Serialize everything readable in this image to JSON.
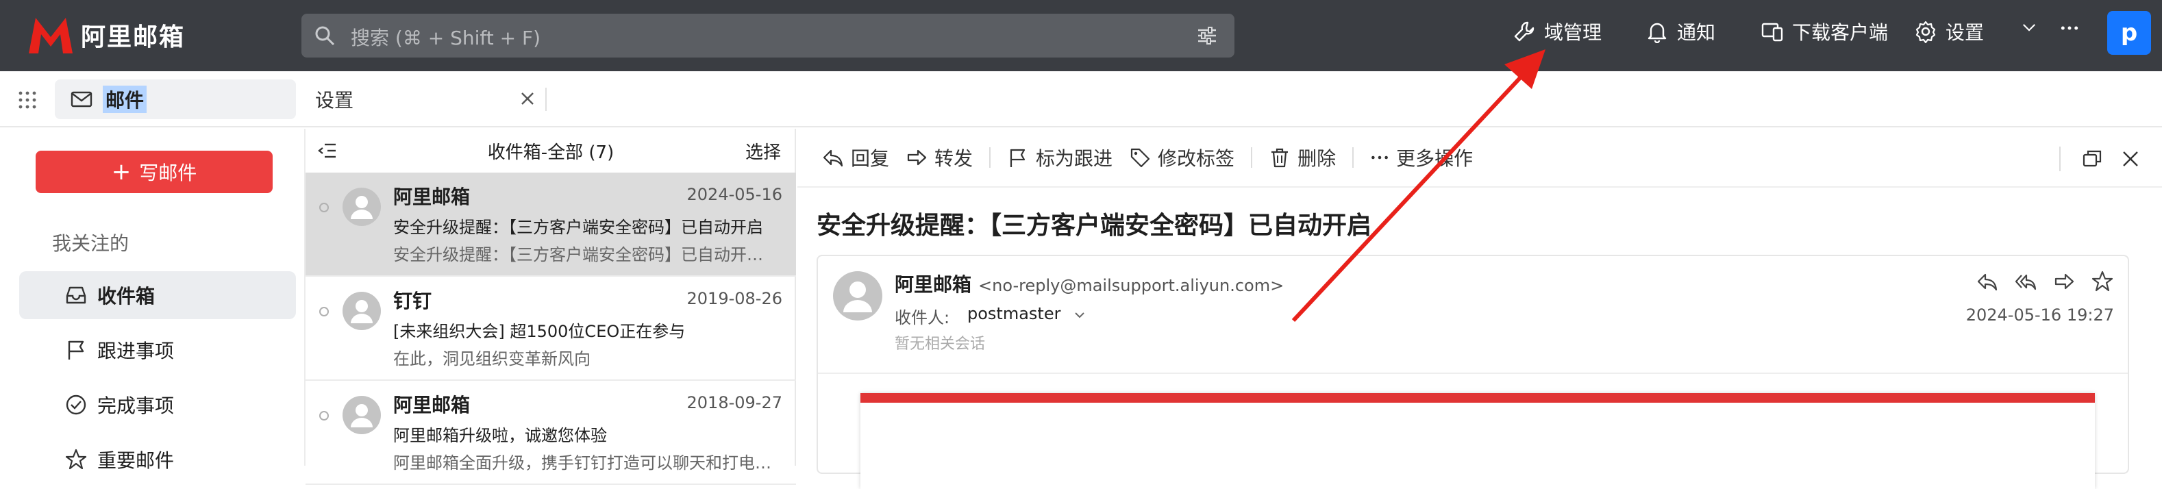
{
  "topbar": {
    "logo_text": "阿里邮箱",
    "search_placeholder": "搜索 (⌘ + Shift + F)",
    "nav": {
      "domain_manage": "域管理",
      "notify": "通知",
      "download_client": "下载客户端",
      "settings": "设置"
    },
    "avatar_letter": "p"
  },
  "tabs": {
    "mail": "邮件",
    "settings": "设置"
  },
  "sidebar": {
    "compose": "写邮件",
    "section": "我关注的",
    "items": [
      {
        "label": "收件箱"
      },
      {
        "label": "跟进事项"
      },
      {
        "label": "完成事项"
      },
      {
        "label": "重要邮件"
      }
    ]
  },
  "list": {
    "title": "收件箱-全部 (7)",
    "select": "选择",
    "items": [
      {
        "sender": "阿里邮箱",
        "date": "2024-05-16",
        "subject": "安全升级提醒：【三方客户端安全密码】已自动开启",
        "preview": "安全升级提醒：【三方客户端安全密码】已自动开启…"
      },
      {
        "sender": "钉钉",
        "date": "2019-08-26",
        "subject": "[未来组织大会] 超1500位CEO正在参与",
        "preview": "在此，洞见组织变革新风向"
      },
      {
        "sender": "阿里邮箱",
        "date": "2018-09-27",
        "subject": "阿里邮箱升级啦，诚邀您体验",
        "preview": "阿里邮箱全面升级，携手钉钉打造可以聊天和打电…"
      }
    ]
  },
  "reader": {
    "toolbar": {
      "reply": "回复",
      "forward": "转发",
      "follow": "标为跟进",
      "tag": "修改标签",
      "delete": "删除",
      "more": "更多操作"
    },
    "title": "安全升级提醒：【三方客户端安全密码】已自动开启",
    "from_name": "阿里邮箱",
    "from_addr": "<no-reply@mailsupport.aliyun.com>",
    "to_label": "收件人:",
    "to_value": "postmaster",
    "timestamp": "2024-05-16 19:27",
    "no_conversation": "暂无相关会话"
  },
  "colors": {
    "topbar": "#3a3d42",
    "accent_red": "#ec3f3f",
    "avatar_blue": "#1677ff",
    "annotation_red": "#e8211a"
  }
}
